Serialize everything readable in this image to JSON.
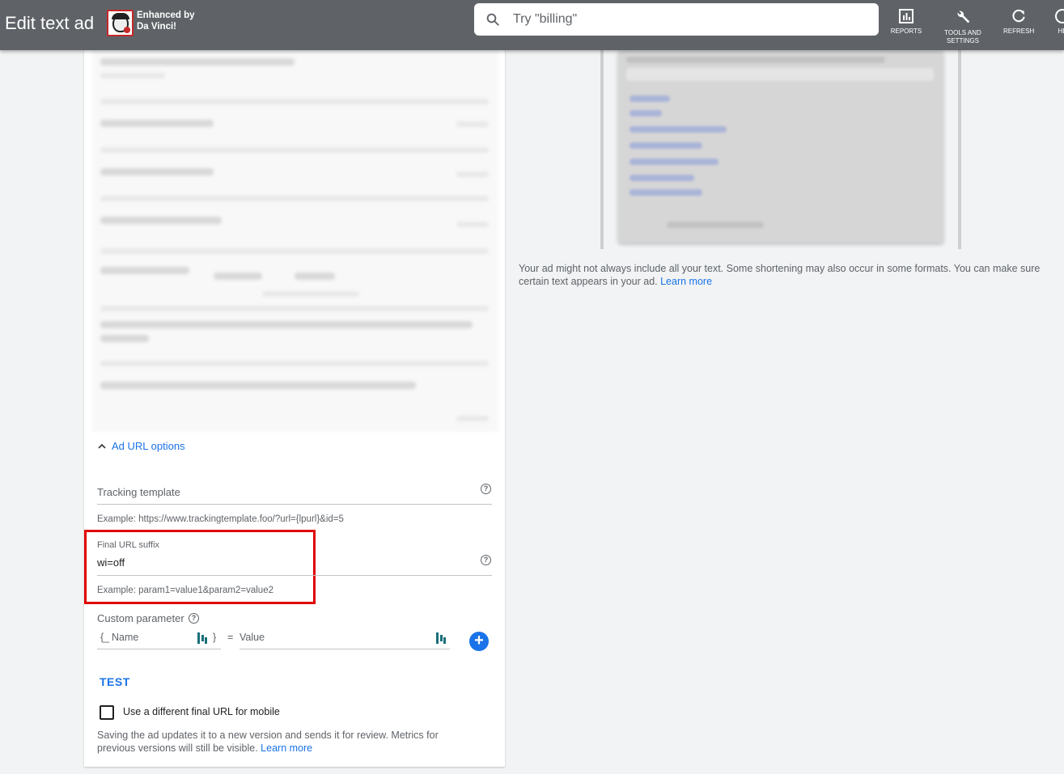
{
  "header": {
    "title": "Edit text ad",
    "extension_line1": "Enhanced by",
    "extension_line2": "Da Vinci!",
    "search_placeholder": "Try \"billing\"",
    "tools": [
      {
        "label": "REPORTS",
        "icon": "reports-icon"
      },
      {
        "label": "TOOLS AND SETTINGS",
        "icon": "wrench-icon"
      },
      {
        "label": "REFRESH",
        "icon": "refresh-icon"
      },
      {
        "label": "HE",
        "icon": "help-icon"
      }
    ]
  },
  "form": {
    "ad_url_options_label": "Ad URL options",
    "tracking_template": {
      "label": "Tracking template",
      "value": "",
      "example": "Example: https://www.trackingtemplate.foo/?url={lpurl}&id=5"
    },
    "final_url_suffix": {
      "label": "Final URL suffix",
      "value": "wi=off",
      "example": "Example: param1=value1&param2=value2"
    },
    "custom_parameter": {
      "label": "Custom parameter",
      "name_prefix": "{_",
      "name_placeholder": "Name",
      "name_suffix": "}",
      "equals": "=",
      "value_placeholder": "Value"
    },
    "test_label": "TEST",
    "mobile_checkbox_label": "Use a different final URL for mobile",
    "mobile_checked": false,
    "save_note": "Saving the ad updates it to a new version and sends it for review. Metrics for previous versions will still be visible.",
    "save_note_link": "Learn more"
  },
  "preview": {
    "note": "Your ad might not always include all your text. Some shortening may also occur in some formats. You can make sure certain text appears in your ad.",
    "note_link": "Learn more"
  },
  "colors": {
    "topbar": "#5f6368",
    "accent": "#1a73e8",
    "highlight": "#e00000"
  }
}
